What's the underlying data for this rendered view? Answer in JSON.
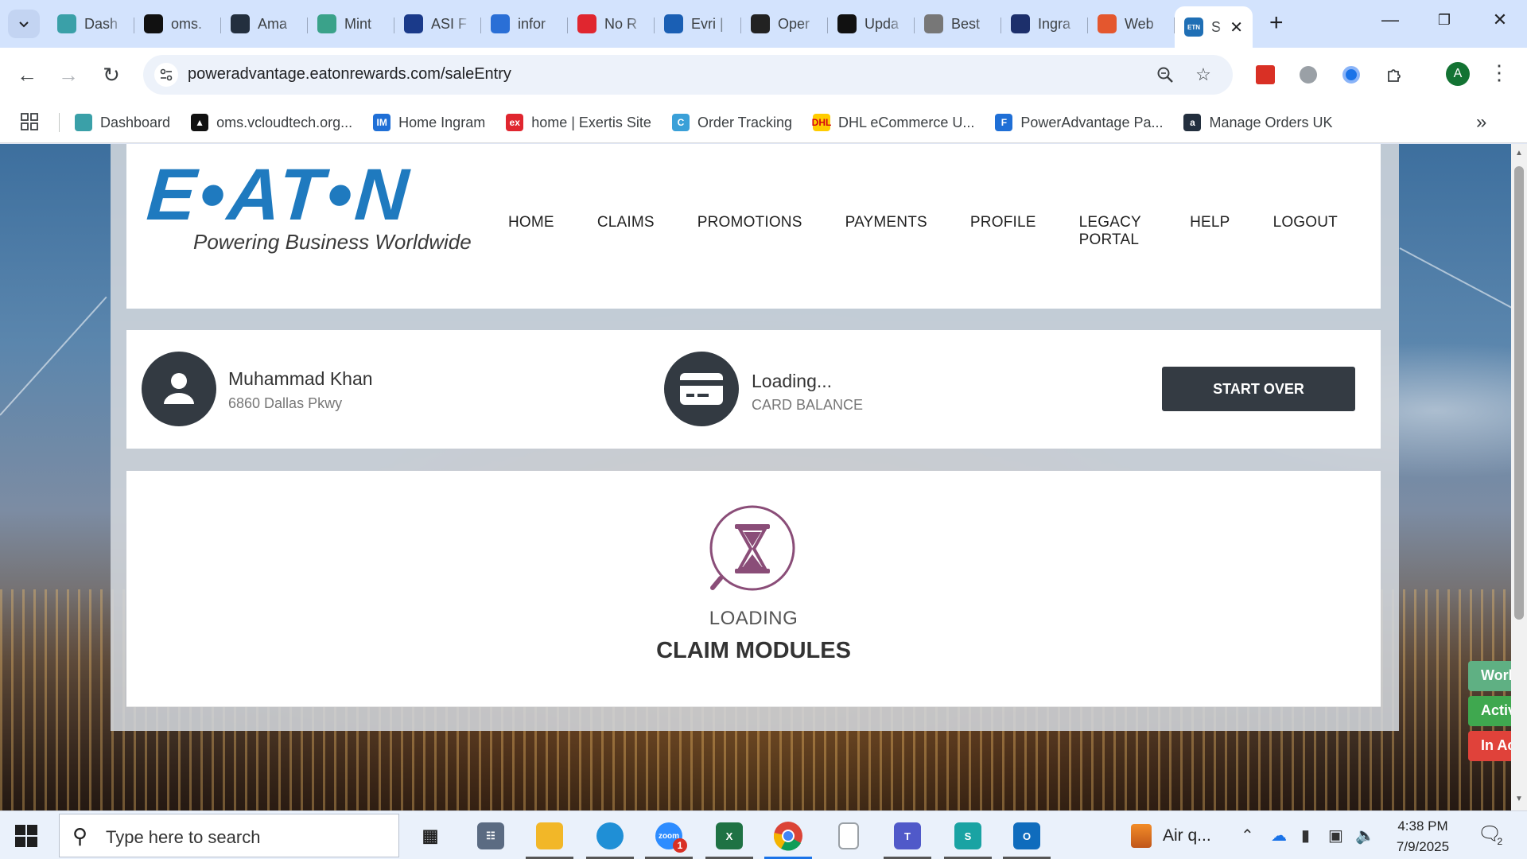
{
  "browser": {
    "tabs": [
      {
        "title": "Dash",
        "icon": "dashboard-icon",
        "color": "#3aa0a8"
      },
      {
        "title": "oms.",
        "icon": "oms-triangle-icon",
        "color": "#111111"
      },
      {
        "title": "Ama",
        "icon": "amazon-icon",
        "color": "#232f3e"
      },
      {
        "title": "Mint",
        "icon": "mint-icon",
        "color": "#3aa28a"
      },
      {
        "title": "ASI F",
        "icon": "asi-arrow-icon",
        "color": "#1a3a8a"
      },
      {
        "title": "infor",
        "icon": "infor-icon",
        "color": "#2a6fd6"
      },
      {
        "title": "No R",
        "icon": "exertis-icon",
        "color": "#e0262f"
      },
      {
        "title": "Evri |",
        "icon": "evri-icon",
        "color": "#1a5fb4"
      },
      {
        "title": "Oper",
        "icon": "openai-icon",
        "color": "#222222"
      },
      {
        "title": "Upda",
        "icon": "openai-icon",
        "color": "#111111"
      },
      {
        "title": "Best",
        "icon": "lightbulb-icon",
        "color": "#777777"
      },
      {
        "title": "Ingra",
        "icon": "ingram-icon",
        "color": "#1c2f6b"
      },
      {
        "title": "Web",
        "icon": "webflow-icon",
        "color": "#e4572e"
      }
    ],
    "active_tab": {
      "title": "S",
      "icon": "eaton-favicon-icon",
      "color": "#1f6fb5",
      "badge": "ETN"
    },
    "new_tab_label": "+",
    "url": "poweradvantage.eatonrewards.com/saleEntry",
    "profile_initial": "A",
    "bookmarks": [
      {
        "label": "Dashboard",
        "icon": "dashboard-icon",
        "color": "#3aa0a8",
        "glyph": ""
      },
      {
        "label": "oms.vcloudtech.org...",
        "icon": "oms-triangle-icon",
        "color": "#111111",
        "glyph": "▲"
      },
      {
        "label": "Home Ingram",
        "icon": "ingram-im-icon",
        "color": "#1f6fd6",
        "glyph": "IM"
      },
      {
        "label": "home | Exertis Site",
        "icon": "exertis-icon",
        "color": "#e0262f",
        "glyph": "ex"
      },
      {
        "label": "Order Tracking",
        "icon": "order-tracking-icon",
        "color": "#3aa0d8",
        "glyph": "C"
      },
      {
        "label": "DHL eCommerce U...",
        "icon": "dhl-icon",
        "color": "#ffcc00",
        "glyph": "DHL"
      },
      {
        "label": "PowerAdvantage Pa...",
        "icon": "poweradvantage-icon",
        "color": "#1f6fd6",
        "glyph": "F"
      },
      {
        "label": "Manage Orders UK",
        "icon": "amazon-icon",
        "color": "#232f3e",
        "glyph": "a"
      }
    ]
  },
  "site": {
    "logo_text": "E•AT•N",
    "logo_tagline": "Powering Business Worldwide",
    "nav": [
      "HOME",
      "CLAIMS",
      "PROMOTIONS",
      "PAYMENTS",
      "PROFILE",
      "LEGACY PORTAL",
      "HELP",
      "LOGOUT"
    ],
    "user": {
      "name": "Muhammad Khan",
      "address": "6860 Dallas Pkwy"
    },
    "balance": {
      "value": "Loading...",
      "label": "CARD BALANCE"
    },
    "start_over_label": "START OVER",
    "loading": {
      "label": "LOADING",
      "title": "CLAIM MODULES"
    },
    "status_tabs": [
      {
        "label": "Working",
        "color": "#5fb083"
      },
      {
        "label": "Active",
        "color": "#3fa84f"
      },
      {
        "label": "In Active",
        "color": "#e0423a"
      }
    ],
    "accent_color": "#1f7abf",
    "hourglass_color": "#8a4d78"
  },
  "taskbar": {
    "search_placeholder": "Type here to search",
    "weather_label": "Air q...",
    "time": "4:38 PM",
    "date": "7/9/2025",
    "notification_count": "2",
    "zoom_badge": "1"
  }
}
